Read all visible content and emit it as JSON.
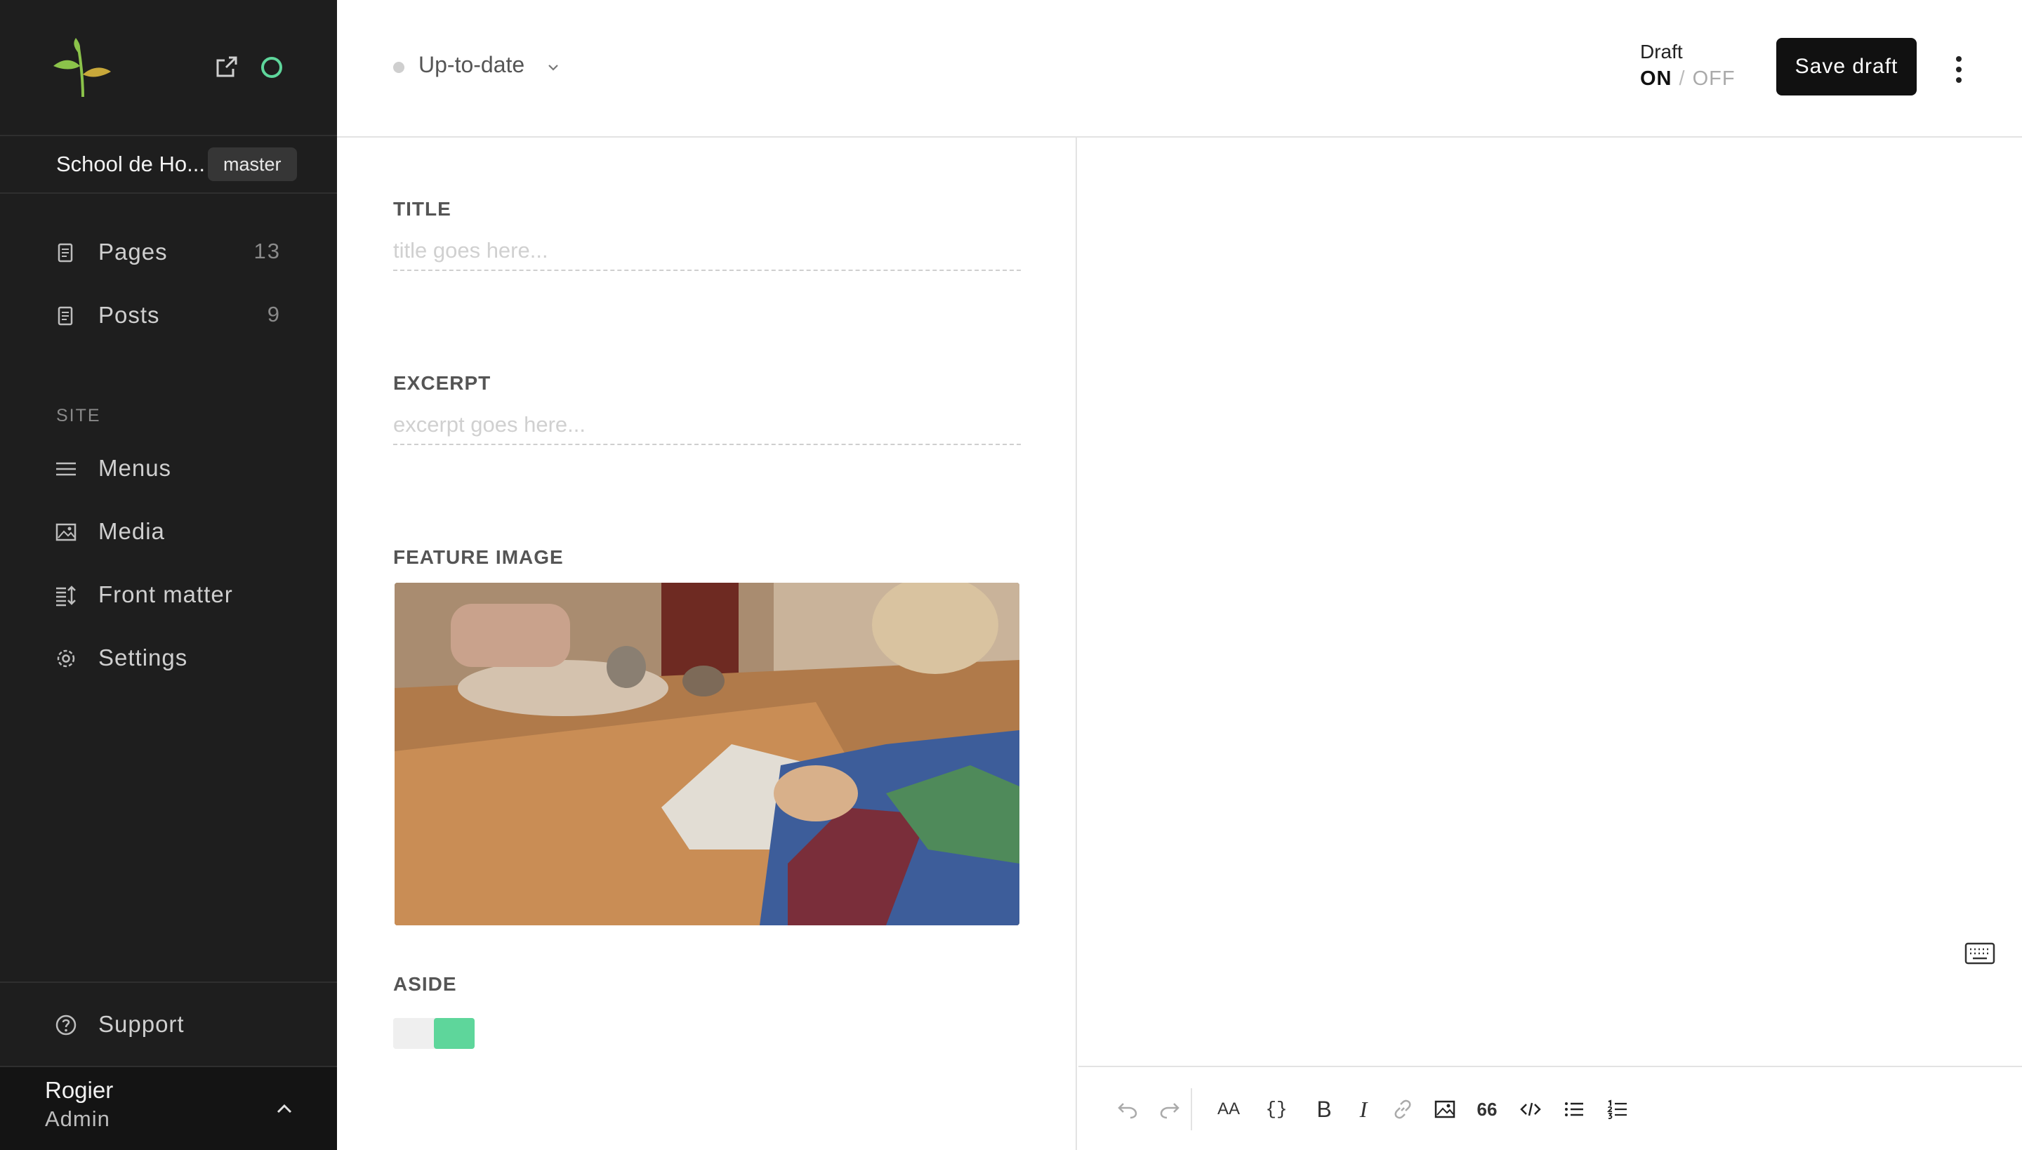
{
  "sidebar": {
    "site_name": "School de Ho...",
    "branch": "master",
    "content_items": [
      {
        "label": "Pages",
        "count": "13",
        "icon": "page-icon"
      },
      {
        "label": "Posts",
        "count": "9",
        "icon": "post-icon"
      }
    ],
    "section_label": "SITE",
    "site_items": [
      {
        "label": "Menus",
        "icon": "menu-icon"
      },
      {
        "label": "Media",
        "icon": "image-icon"
      },
      {
        "label": "Front matter",
        "icon": "front-matter-icon"
      },
      {
        "label": "Settings",
        "icon": "gear-icon"
      }
    ],
    "support_label": "Support",
    "user": {
      "name": "Rogier",
      "role": "Admin"
    }
  },
  "header": {
    "status": "Up-to-date",
    "draft_label": "Draft",
    "draft_on": "ON",
    "draft_separator": "/",
    "draft_off": "OFF",
    "save_label": "Save draft"
  },
  "form": {
    "title_label": "TITLE",
    "title_placeholder": "title goes here...",
    "excerpt_label": "EXCERPT",
    "excerpt_placeholder": "excerpt goes here...",
    "feature_label": "FEATURE IMAGE",
    "aside_label": "ASIDE",
    "aside_enabled": true
  },
  "toolbar": {
    "heading_glyph": "AA",
    "code_glyph": "{}",
    "bold_glyph": "B",
    "italic_glyph": "I",
    "quote_glyph": "66"
  },
  "colors": {
    "sidebar_bg": "#1e1e1e",
    "accent_green": "#5ed69b",
    "button_bg": "#111111"
  }
}
